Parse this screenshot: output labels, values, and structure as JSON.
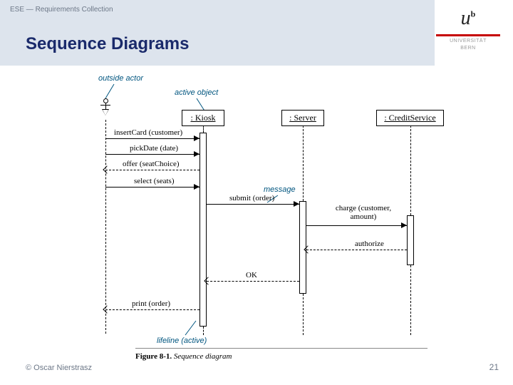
{
  "breadcrumb": "ESE — Requirements Collection",
  "title": "Sequence Diagrams",
  "university": {
    "name1": "UNIVERSITÄT",
    "name2": "BERN"
  },
  "footer": {
    "copyright": "© Oscar Nierstrasz",
    "page": "21"
  },
  "caption": {
    "fig": "Figure 8-1.",
    "desc": "Sequence diagram"
  },
  "annotations": {
    "outside_actor": "outside actor",
    "active_object": "active object",
    "message": "message",
    "lifeline_active": "lifeline (active)"
  },
  "objects": {
    "kiosk": ": Kiosk",
    "server": ": Server",
    "credit": ": CreditService"
  },
  "messages": {
    "m1": "insertCard (customer)",
    "m2": "pickDate (date)",
    "m3": "offer (seatChoice)",
    "m4": "select (seats)",
    "m5": "submit (order)",
    "m6": "charge (customer, amount)",
    "m7": "authorize",
    "m8": "OK",
    "m9": "print (order)"
  }
}
